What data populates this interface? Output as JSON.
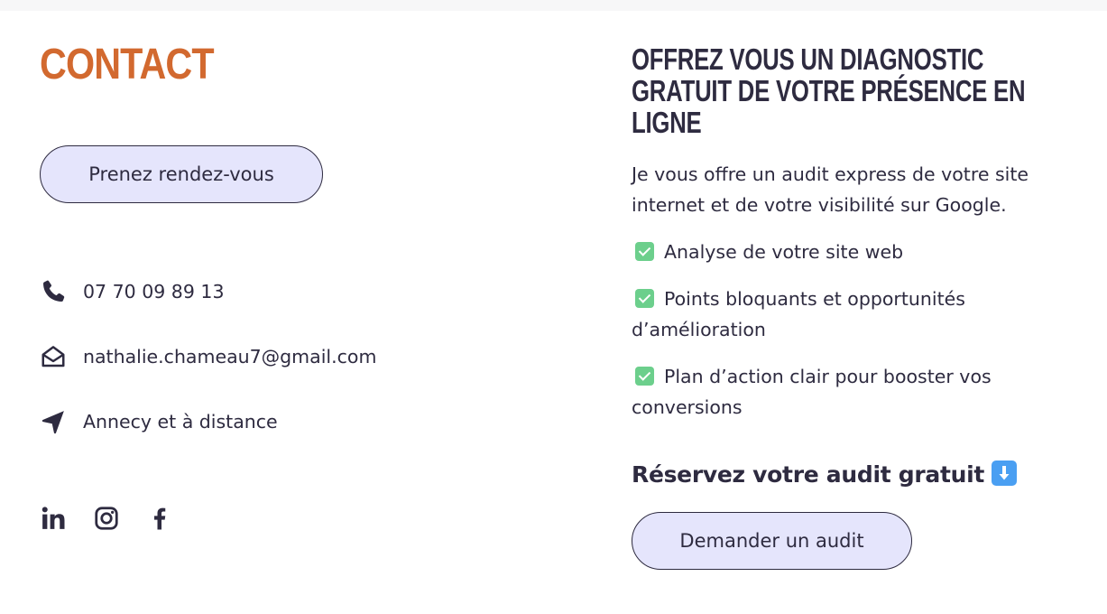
{
  "contact": {
    "title": "CONTACT",
    "appointment_button": "Prenez rendez-vous",
    "phone": "07 70 09 89 13",
    "email": "nathalie.chameau7@gmail.com",
    "location": "Annecy et à distance",
    "icons": {
      "phone": "phone-icon",
      "email": "envelope-open-icon",
      "location": "location-arrow-icon"
    },
    "social": [
      "linkedin-icon",
      "instagram-icon",
      "facebook-icon"
    ]
  },
  "offer": {
    "title": "OFFREZ VOUS UN DIAGNOSTIC GRATUIT DE VOTRE PRÉSENCE EN LIGNE",
    "intro": "Je vous offre un audit express de votre site internet et de votre visibilité sur Google.",
    "items": [
      "Analyse de votre site web",
      "Points bloquants et opportunités d’amélioration",
      "Plan d’action clair pour booster vos conversions"
    ],
    "cta_heading": "Réservez votre audit gratuit",
    "cta_button": "Demander un audit"
  },
  "colors": {
    "accent": "#d2692f",
    "text": "#2e2b40",
    "button_bg": "#e5e5fc",
    "check": "#6ccf8c",
    "arrow_emoji": "#4a9ff2"
  }
}
